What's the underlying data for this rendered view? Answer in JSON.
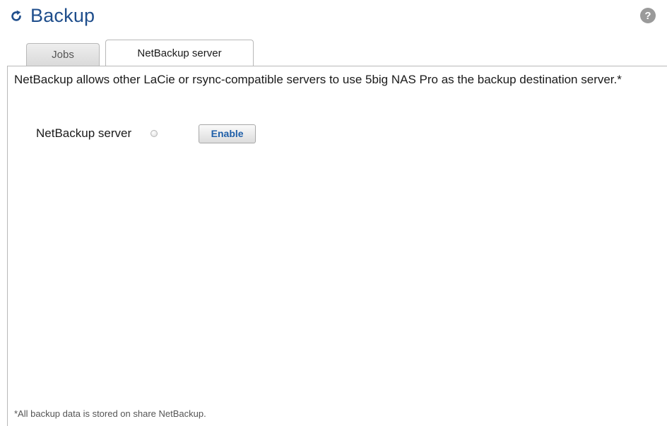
{
  "header": {
    "title": "Backup",
    "refresh_icon": "refresh-icon",
    "help_icon": "help-icon",
    "help_glyph": "?",
    "accent_color": "#1f4e8c"
  },
  "tabs": [
    {
      "label": "Jobs",
      "active": false
    },
    {
      "label": "NetBackup server",
      "active": true
    }
  ],
  "main": {
    "description": "NetBackup allows other LaCie or rsync-compatible servers to use 5big NAS Pro as the backup destination server.*",
    "server": {
      "label": "NetBackup server",
      "status": "disabled",
      "status_icon": "status-dot-icon",
      "button_label": "Enable"
    },
    "footnote": "*All backup data is stored on share NetBackup."
  }
}
